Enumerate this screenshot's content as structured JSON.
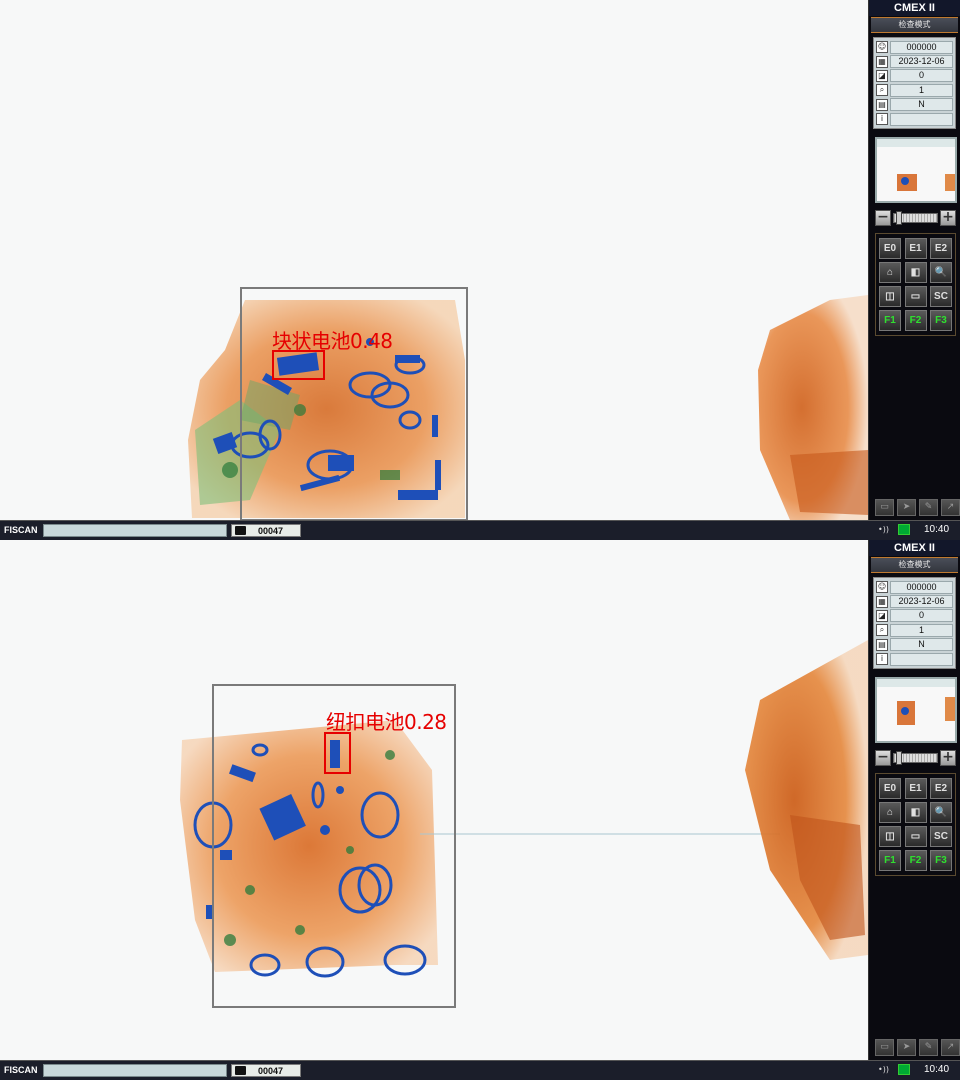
{
  "screens": [
    {
      "brand": "CMEX II",
      "mode": "检查模式",
      "info": [
        {
          "icon": "user-icon",
          "value": "000000"
        },
        {
          "icon": "calendar-icon",
          "value": "2023-12-06"
        },
        {
          "icon": "counter-icon",
          "value": "0"
        },
        {
          "icon": "zoom-icon",
          "value": "1"
        },
        {
          "icon": "printer-icon",
          "value": "N"
        },
        {
          "icon": "info-icon",
          "value": ""
        }
      ],
      "detection": {
        "label": "块状电池0.48"
      },
      "buttons": [
        "E0",
        "E1",
        "E2",
        "⌂",
        "◧",
        "🔍",
        "◫",
        "▭",
        "SC",
        "F1",
        "F2",
        "F3"
      ],
      "status": {
        "app": "FISCAN",
        "field": "",
        "bag_count": "00047",
        "time": "10:40"
      }
    },
    {
      "brand": "CMEX II",
      "mode": "检查模式",
      "info": [
        {
          "icon": "user-icon",
          "value": "000000"
        },
        {
          "icon": "calendar-icon",
          "value": "2023-12-06"
        },
        {
          "icon": "counter-icon",
          "value": "0"
        },
        {
          "icon": "zoom-icon",
          "value": "1"
        },
        {
          "icon": "printer-icon",
          "value": "N"
        },
        {
          "icon": "info-icon",
          "value": ""
        }
      ],
      "detection": {
        "label": "纽扣电池0.28"
      },
      "buttons": [
        "E0",
        "E1",
        "E2",
        "⌂",
        "◧",
        "🔍",
        "◫",
        "▭",
        "SC",
        "F1",
        "F2",
        "F3"
      ],
      "status": {
        "app": "FISCAN",
        "field": "",
        "bag_count": "00047",
        "time": "10:40"
      }
    }
  ],
  "colors": {
    "detection": "#e60000",
    "accent_orange": "#c07a30",
    "function_key": "#2fe02f",
    "panel_bg": "#0a0a10"
  }
}
